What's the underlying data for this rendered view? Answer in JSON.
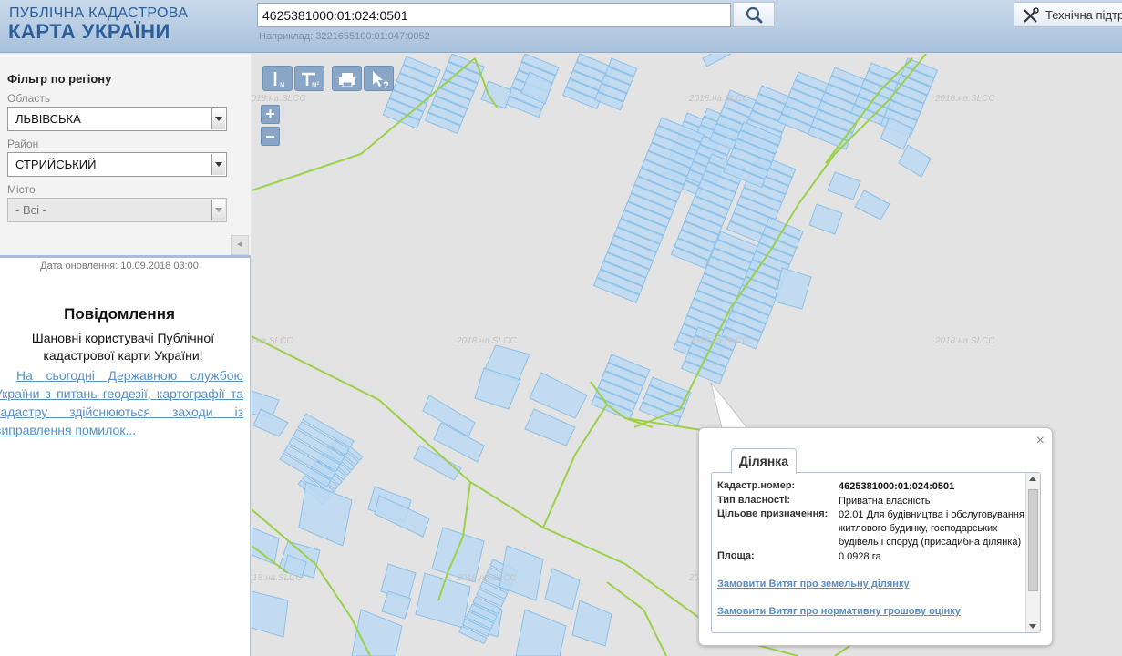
{
  "header": {
    "logo_line1": "ПУБЛІЧНА КАДАСТРОВА",
    "logo_line2": "КАРТА УКРАЇНИ",
    "search_value": "4625381000:01:024:0501",
    "search_example": "Наприклад: 3221655100:01:047:0052",
    "support_label": "Технічна підтримка"
  },
  "sidebar": {
    "filter_title": "Фільтр по регіону",
    "region_label": "Область",
    "region_value": "ЛЬВІВСЬКА",
    "district_label": "Район",
    "district_value": "СТРИЙСЬКИЙ",
    "city_label": "Місто",
    "city_value": "- Всі -",
    "collapse_icon": "◄",
    "update_date": "Дата оновлення: 10.09.2018 03:00",
    "notice_title": "Повідомлення",
    "notice_greeting": "Шановні користувачі Публічної кадастрової карти України!",
    "notice_link": "На сьогодні Державною службою України з питань геодезії, картографії та кадастру здійснюються заходи із виправлення помилок..."
  },
  "map": {
    "watermark": "2018.на.SLCC",
    "zoom_in": "+",
    "zoom_out": "–",
    "tool_ruler_unit": "м",
    "tool_area_unit": "м²",
    "tool_identify_mark": "?"
  },
  "popup": {
    "tab_label": "Ділянка",
    "close": "×",
    "rows": [
      {
        "key": "Кадастр.номер:",
        "value": "4625381000:01:024:0501"
      },
      {
        "key": "Тип власності:",
        "value": "Приватна власність"
      },
      {
        "key": "Цільове призначення:",
        "value": "02.01 Для будівництва і обслуговування житлового будинку, господарських будівель і споруд (присадибна ділянка)"
      },
      {
        "key": "Площа:",
        "value": "0.0928 га"
      }
    ],
    "link_extract": "Замовити Витяг про земельну ділянку",
    "link_valuation": "Замовити Витяг про нормативну грошову оцінку"
  },
  "colors": {
    "parcel_fill": "#bcd9f2",
    "parcel_stroke": "#8cc0e8",
    "boundary": "#9bd04a",
    "link": "#5a8fc5"
  }
}
